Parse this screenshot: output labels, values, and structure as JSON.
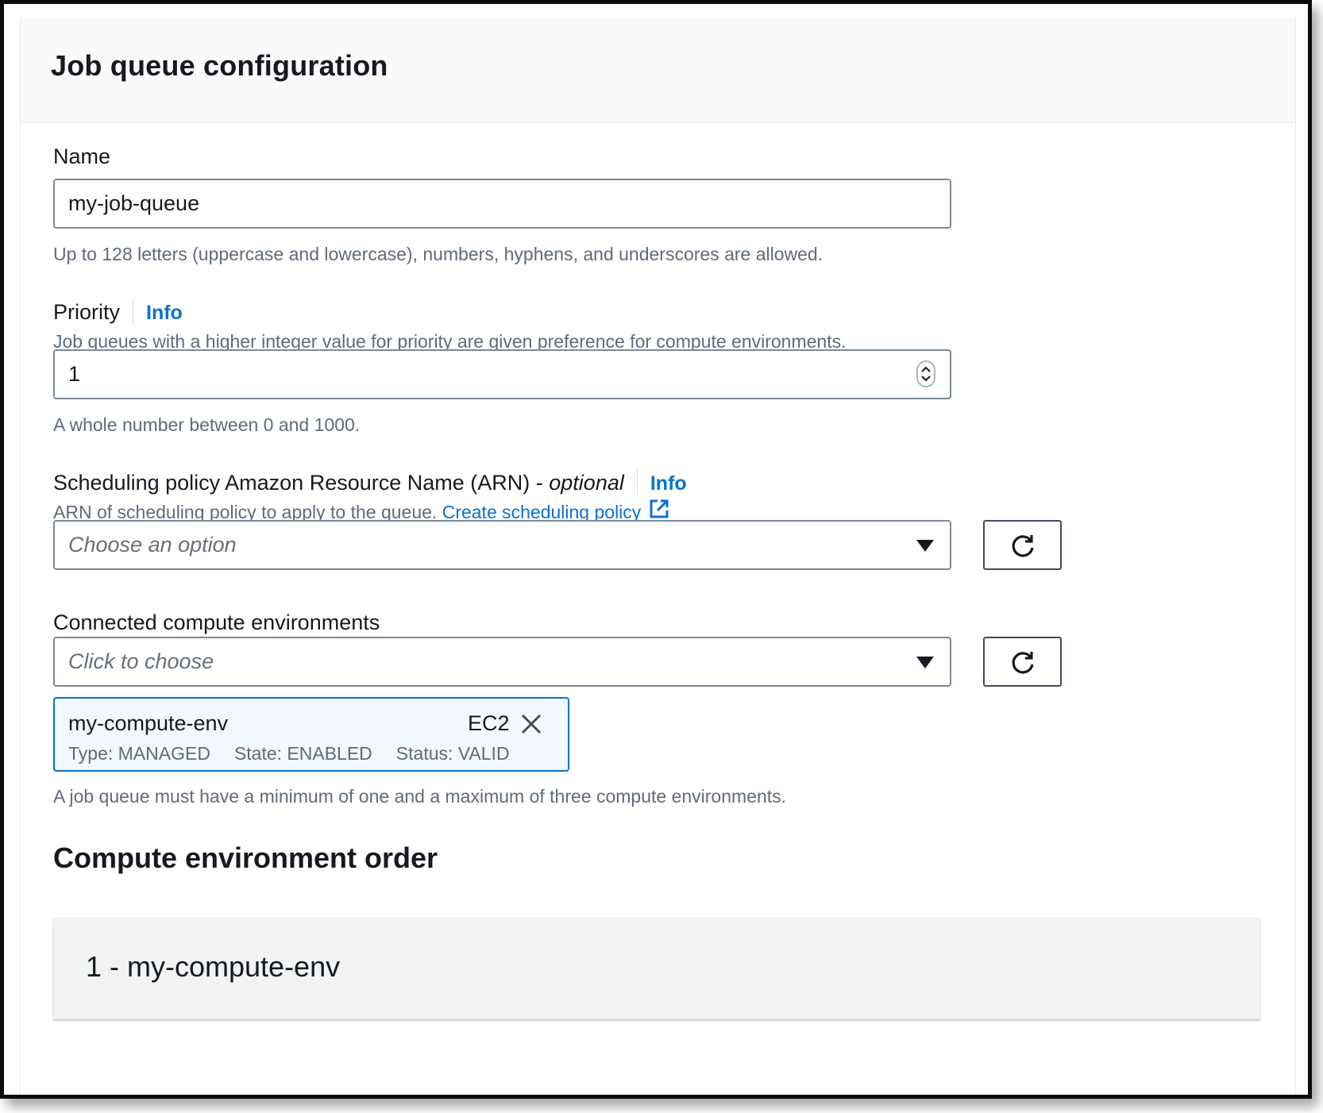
{
  "panel": {
    "title": "Job queue configuration"
  },
  "name_field": {
    "label": "Name",
    "value": "my-job-queue",
    "constraint": "Up to 128 letters (uppercase and lowercase), numbers, hyphens, and underscores are allowed."
  },
  "priority_field": {
    "label": "Priority",
    "info_link": "Info",
    "description": "Job queues with a higher integer value for priority are given preference for compute environments.",
    "value": "1",
    "constraint": "A whole number between 0 and 1000."
  },
  "scheduling_policy": {
    "label": "Scheduling policy Amazon Resource Name (ARN) - ",
    "optional": "optional",
    "info_link": "Info",
    "description": "ARN of scheduling policy to apply to the queue.",
    "create_link": "Create scheduling policy",
    "placeholder": "Choose an option"
  },
  "compute_environments": {
    "label": "Connected compute environments",
    "placeholder": "Click to choose",
    "selected": {
      "name": "my-compute-env",
      "platform": "EC2",
      "type": "Type: MANAGED",
      "state": "State: ENABLED",
      "status": "Status: VALID"
    },
    "constraint": "A job queue must have a minimum of one and a maximum of three compute environments."
  },
  "order_section": {
    "title": "Compute environment order",
    "items": [
      "1 - my-compute-env"
    ]
  },
  "colors": {
    "link": "#0972d3",
    "text": "#16191f",
    "secondary_text": "#5f6b7a",
    "token_bg": "#f2f8fd",
    "header_bg": "#fafafa"
  },
  "icons": [
    "number-spinner-icon",
    "caret-down-icon",
    "refresh-icon",
    "external-link-icon",
    "close-icon"
  ]
}
